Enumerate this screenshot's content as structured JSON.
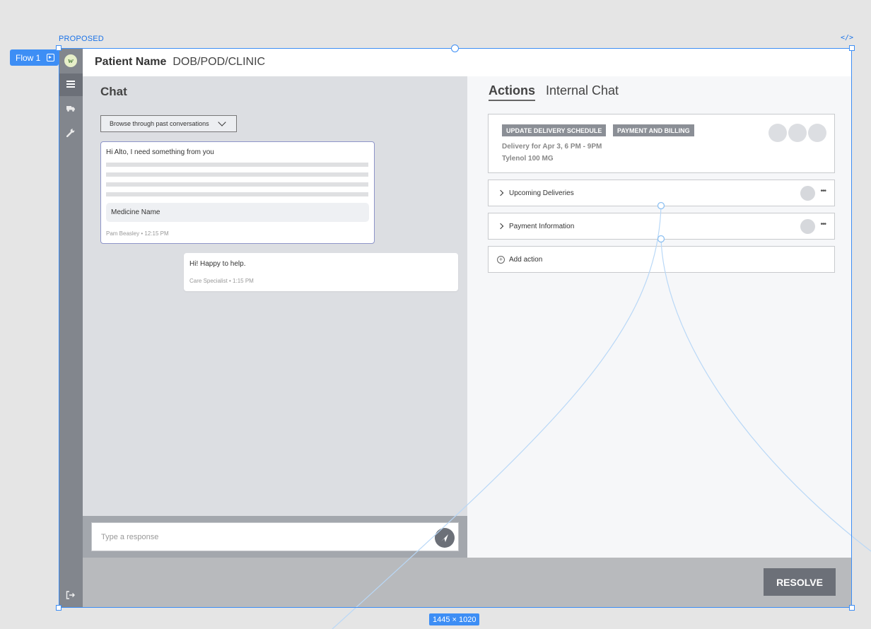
{
  "canvas": {
    "frame_label": "PROPOSED",
    "code_icon": "</>",
    "flow_label": "Flow 1",
    "size_label": "1445 × 1020"
  },
  "sidebar": {
    "logo_letter": "w",
    "icons": [
      "list-icon",
      "truck-icon",
      "wrench-icon",
      "logout-icon"
    ]
  },
  "header": {
    "patient_name": "Patient Name",
    "patient_meta": "DOB/POD/CLINIC"
  },
  "chat": {
    "title": "Chat",
    "browse_label": "Browse through past conversations",
    "incoming": {
      "text": "Hi Alto, I need something from you",
      "medicine": "Medicine Name",
      "meta": "Pam Beasley  •  12:15 PM"
    },
    "outgoing": {
      "text": "Hi! Happy to help.",
      "meta": "Care Specialist  •  1:15 PM"
    },
    "composer_placeholder": "Type a response"
  },
  "actions": {
    "tabs": [
      "Actions",
      "Internal Chat"
    ],
    "card": {
      "tags": [
        "UPDATE DELIVERY SCHEDULE",
        "PAYMENT AND BILLING"
      ],
      "line1": "Delivery for Apr 3, 6 PM - 9PM",
      "line2": "Tylenol 100 MG"
    },
    "rows": [
      {
        "label": "Upcoming Deliveries",
        "more": "•••"
      },
      {
        "label": "Payment Information",
        "more": "•••"
      }
    ],
    "add_action": "Add action"
  },
  "footer": {
    "resolve_label": "RESOLVE"
  },
  "colors": {
    "selection": "#3d8ef5",
    "sidebar": "#82868d",
    "button": "#6c7078",
    "chat_bg": "#dcdee2"
  }
}
